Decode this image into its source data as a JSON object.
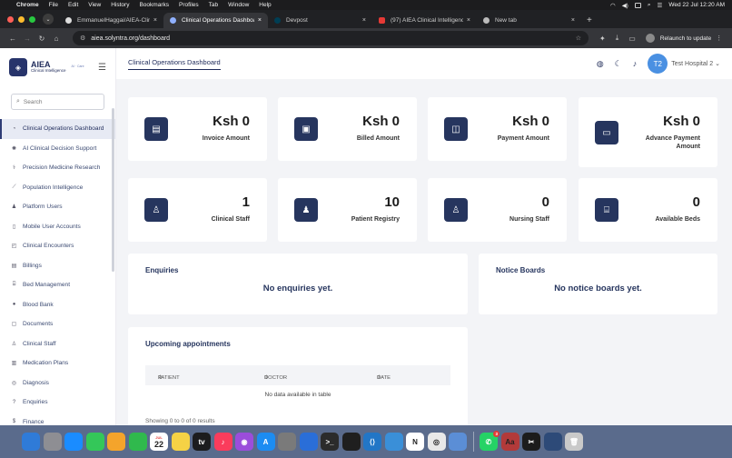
{
  "menubar": {
    "app_name": "Chrome",
    "items": [
      "File",
      "Edit",
      "View",
      "History",
      "Bookmarks",
      "Profiles",
      "Tab",
      "Window",
      "Help"
    ],
    "datetime": "Wed 22 Jul  12:20 AM"
  },
  "browser": {
    "tabs": [
      {
        "title": "EmmanuelHaggai/AIEA-Clini",
        "active": false
      },
      {
        "title": "Clinical Operations Dashboa",
        "active": true
      },
      {
        "title": "Devpost",
        "active": false
      },
      {
        "title": "(97) AIEA Clinical Intelligence",
        "active": false
      },
      {
        "title": "New tab",
        "active": false
      }
    ],
    "tab_menu_icon": "chevron-down",
    "url": "aiea.solyntra.org/dashboard",
    "relaunch_label": "Relaunch to update"
  },
  "sidebar": {
    "logo_title": "AIEA",
    "logo_subtitle": "Clinical Intelligence",
    "logo_badge": "AI · Care",
    "search_placeholder": "Search",
    "items": [
      {
        "label": "Clinical Operations Dashboard",
        "icon": "dashboard-icon",
        "active": true
      },
      {
        "label": "AI Clinical Decision Support",
        "icon": "brain-icon"
      },
      {
        "label": "Precision Medicine Research",
        "icon": "dna-icon"
      },
      {
        "label": "Population Intelligence",
        "icon": "chart-icon"
      },
      {
        "label": "Platform Users",
        "icon": "users-icon"
      },
      {
        "label": "Mobile User Accounts",
        "icon": "mobile-icon"
      },
      {
        "label": "Clinical Encounters",
        "icon": "encounter-icon"
      },
      {
        "label": "Billings",
        "icon": "billing-icon"
      },
      {
        "label": "Bed Management",
        "icon": "bed-icon"
      },
      {
        "label": "Blood Bank",
        "icon": "blood-drop-icon"
      },
      {
        "label": "Documents",
        "icon": "document-icon"
      },
      {
        "label": "Clinical Staff",
        "icon": "staff-icon"
      },
      {
        "label": "Medication Plans",
        "icon": "medication-icon"
      },
      {
        "label": "Diagnosis",
        "icon": "diagnosis-icon"
      },
      {
        "label": "Enquiries",
        "icon": "question-icon"
      },
      {
        "label": "Finance",
        "icon": "finance-icon"
      }
    ]
  },
  "topbar": {
    "page_title": "Clinical Operations Dashboard",
    "avatar_initials": "T2",
    "hospital_name": "Test Hospital 2"
  },
  "stats": [
    {
      "value": "Ksh 0",
      "label": "Invoice Amount",
      "icon": "invoice-icon"
    },
    {
      "value": "Ksh 0",
      "label": "Billed Amount",
      "icon": "cash-icon"
    },
    {
      "value": "Ksh 0",
      "label": "Payment Amount",
      "icon": "payment-icon"
    },
    {
      "value": "Ksh 0",
      "label": "Advance Payment Amount",
      "icon": "advance-payment-icon"
    },
    {
      "value": "1",
      "label": "Clinical Staff",
      "icon": "staff-badge-icon"
    },
    {
      "value": "10",
      "label": "Patient Registry",
      "icon": "patient-icon"
    },
    {
      "value": "0",
      "label": "Nursing Staff",
      "icon": "nurse-icon"
    },
    {
      "value": "0",
      "label": "Available Beds",
      "icon": "bed-icon"
    }
  ],
  "enquiries": {
    "title": "Enquiries",
    "empty_text": "No enquiries yet."
  },
  "notices": {
    "title": "Notice Boards",
    "empty_text": "No notice boards yet."
  },
  "appointments": {
    "title": "Upcoming appointments",
    "columns": [
      "PATIENT",
      "DOCTOR",
      "DATE"
    ],
    "empty_text": "No data available in table",
    "footer_text": "Showing 0 to 0 of 0 results"
  },
  "dock": {
    "apps": [
      "Finder",
      "Launchpad",
      "Safari",
      "Messages",
      "Photos",
      "FaceTime",
      "Calendar",
      "Notes",
      "Apple TV",
      "Music",
      "Podcasts",
      "App Store",
      "System Settings",
      "Xcode",
      "Terminal",
      "ChatGPT",
      "VS Code",
      "Mail",
      "Notion",
      "Chrome",
      "Preview",
      "WhatsApp",
      "Dictionary",
      "CapCut",
      "Screenshot",
      "Trash"
    ],
    "calendar_day": "22",
    "calendar_month": "JUL",
    "whatsapp_badge": "3"
  }
}
